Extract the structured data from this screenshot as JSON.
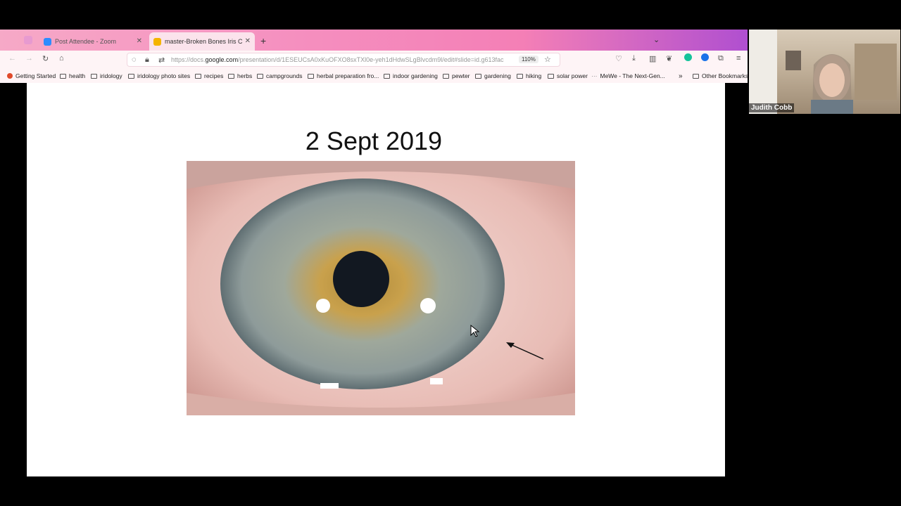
{
  "tabs": [
    {
      "title": "Post Attendee - Zoom",
      "icon": "zoom-icon"
    },
    {
      "title": "master-Broken Bones Iris Chan",
      "icon": "slides-icon"
    }
  ],
  "nav": {
    "url_prefix": "https://docs.",
    "url_host": "google.com",
    "url_path": "/presentation/d/1ESEUCsA0xKuOFXO8sxTXl0e-yeh1dHdwSLgBlvcdm9l/edit#slide=id.g613fac",
    "zoom": "110%"
  },
  "bookmarks": [
    {
      "label": "Getting Started",
      "type": "favicon"
    },
    {
      "label": "health",
      "type": "folder"
    },
    {
      "label": "iridology",
      "type": "folder"
    },
    {
      "label": "iridology photo sites",
      "type": "folder"
    },
    {
      "label": "recipes",
      "type": "folder"
    },
    {
      "label": "herbs",
      "type": "folder"
    },
    {
      "label": "campgrounds",
      "type": "folder"
    },
    {
      "label": "herbal preparation fro...",
      "type": "folder"
    },
    {
      "label": "indoor gardening",
      "type": "folder"
    },
    {
      "label": "pewter",
      "type": "folder"
    },
    {
      "label": "gardening",
      "type": "folder"
    },
    {
      "label": "hiking",
      "type": "folder"
    },
    {
      "label": "solar power",
      "type": "folder"
    },
    {
      "label": "MeWe - The Next-Gen...",
      "type": "link"
    },
    {
      "label": "Other Bookmarks",
      "type": "folder"
    }
  ],
  "slide": {
    "title": "2 Sept 2019"
  },
  "participant": {
    "name": "Judith Cobb"
  },
  "colors": {
    "tabstrip": "#f58fbf",
    "slide_bg": "#ffffff"
  }
}
